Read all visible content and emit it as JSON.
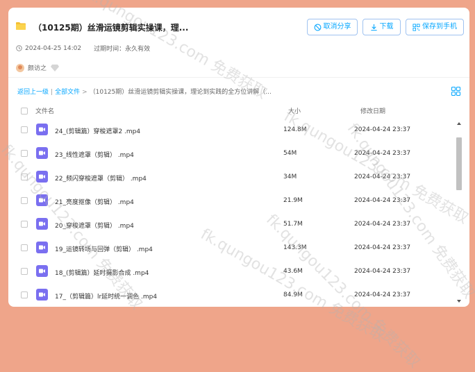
{
  "share": {
    "title": "（10125期）丝滑运镜剪辑实操课，理...",
    "buttons": {
      "cancel_share": "取消分享",
      "download": "下载",
      "save_to_phone": "保存到手机"
    },
    "date": "2024-04-25 14:02",
    "expire_label": "过期时间：",
    "expire_value": "永久有效",
    "sharer_name": "颜访之"
  },
  "breadcrumb": {
    "back": "返回上一级",
    "all_files": "全部文件",
    "current": "（10125期）丝滑运镜剪辑实操课，理论到实践的全方位讲解（..."
  },
  "columns": {
    "name": "文件名",
    "size": "大小",
    "modified": "修改日期"
  },
  "files": [
    {
      "name": "24_(剪辑篇）穿梭遮罩2 .mp4",
      "size": "124.8M",
      "date": "2024-04-24 23:37"
    },
    {
      "name": "23_线性遮罩（剪辑） .mp4",
      "size": "54M",
      "date": "2024-04-24 23:37"
    },
    {
      "name": "22_频闪穿梭遮罩（剪辑） .mp4",
      "size": "34M",
      "date": "2024-04-24 23:37"
    },
    {
      "name": "21_亮度抠像（剪辑） .mp4",
      "size": "21.9M",
      "date": "2024-04-24 23:37"
    },
    {
      "name": "20_穿梭遮罩（剪辑） .mp4",
      "size": "51.7M",
      "date": "2024-04-24 23:37"
    },
    {
      "name": "19_运镜转场与回弹（剪辑） .mp4",
      "size": "143.3M",
      "date": "2024-04-24 23:37"
    },
    {
      "name": "18_(剪辑篇）延时摄影合成 .mp4",
      "size": "43.6M",
      "date": "2024-04-24 23:37"
    },
    {
      "name": "17_（剪辑篇）lr延时统一调色 .mp4",
      "size": "84.9M",
      "date": "2024-04-24 23:37"
    }
  ],
  "watermark": "fk.qungou123.com 免费获取",
  "colors": {
    "background": "#efa58a",
    "accent": "#06a7ff",
    "video_icon": "#7a6ff0"
  }
}
